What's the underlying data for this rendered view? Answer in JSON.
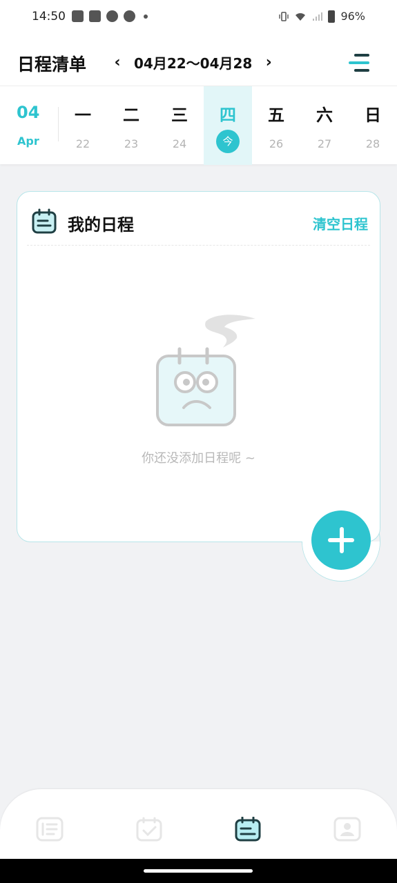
{
  "status_bar": {
    "time": "14:50",
    "battery": "96%"
  },
  "header": {
    "title": "日程清单",
    "prev_label": "‹",
    "next_label": "›",
    "week_range": "04月22～04月28"
  },
  "week": {
    "month_num": "04",
    "month_name": "Apr",
    "days": [
      {
        "weekday": "一",
        "date": "22"
      },
      {
        "weekday": "二",
        "date": "23"
      },
      {
        "weekday": "三",
        "date": "24"
      },
      {
        "weekday": "四",
        "date": "今",
        "today": true
      },
      {
        "weekday": "五",
        "date": "26"
      },
      {
        "weekday": "六",
        "date": "27"
      },
      {
        "weekday": "日",
        "date": "28"
      }
    ]
  },
  "schedule_card": {
    "title": "我的日程",
    "clear_label": "清空日程",
    "empty_text": "你还没添加日程呢 ~"
  },
  "colors": {
    "accent": "#2ec4cf",
    "background": "#f1f2f4"
  },
  "bottom_nav": {
    "items": [
      "list-icon",
      "check-calendar-icon",
      "schedule-icon",
      "profile-icon"
    ],
    "active": "schedule-icon"
  }
}
